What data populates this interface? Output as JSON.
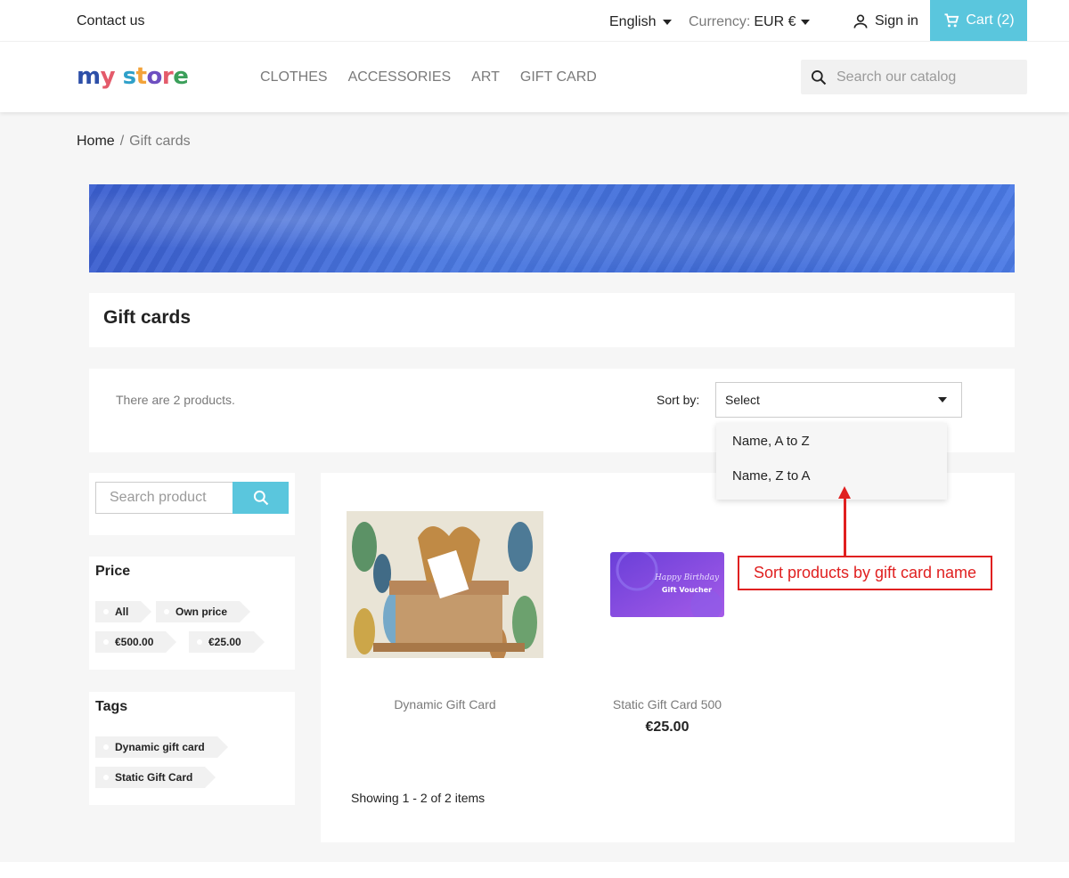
{
  "topbar": {
    "contact": "Contact us",
    "language": "English",
    "currency_label": "Currency:",
    "currency_value": "EUR €",
    "signin": "Sign in",
    "cart": "Cart (2)"
  },
  "header": {
    "logo": {
      "m": "m",
      "y": "y",
      "space": " ",
      "s": "s",
      "t": "t",
      "o": "o",
      "r": "r",
      "e": "e"
    },
    "menu": [
      "CLOTHES",
      "ACCESSORIES",
      "ART",
      "GIFT CARD"
    ],
    "search_placeholder": "Search our catalog"
  },
  "breadcrumb": {
    "home": "Home",
    "separator": "/",
    "current": "Gift cards"
  },
  "category": {
    "title": "Gift cards"
  },
  "sort": {
    "count_text": "There are 2 products.",
    "label": "Sort by:",
    "selected": "Select",
    "options": [
      "Name, A to Z",
      "Name, Z to A"
    ]
  },
  "sidebar": {
    "search_placeholder": "Search product",
    "price": {
      "title": "Price",
      "filters": [
        "All",
        "Own price",
        "€500.00",
        "€25.00"
      ]
    },
    "tags": {
      "title": "Tags",
      "filters": [
        "Dynamic gift card",
        "Static Gift Card"
      ]
    }
  },
  "products": [
    {
      "name": "Dynamic Gift Card",
      "price": ""
    },
    {
      "name": "Static Gift Card 500",
      "price": "€25.00",
      "image_text_1": "Happy Birthday",
      "image_text_2": "Gift Voucher"
    }
  ],
  "showing": "Showing 1 - 2 of 2 items",
  "annotation": "Sort products by gift card name",
  "colors": {
    "accent": "#5ac6dd",
    "annotation": "#e02020"
  }
}
